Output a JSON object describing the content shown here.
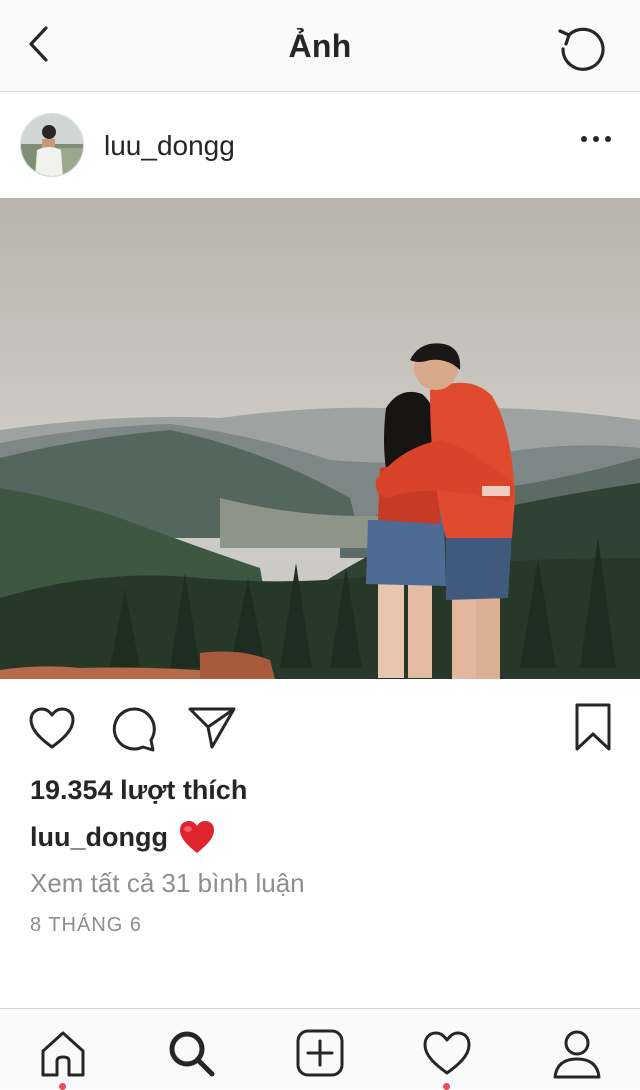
{
  "header": {
    "title": "Ảnh",
    "back_icon": "chevron-left-icon",
    "refresh_icon": "refresh-icon"
  },
  "post": {
    "username": "luu_dongg",
    "more_icon": "more-horizontal-icon",
    "photo_alt": "",
    "likes_text": "19.354 lượt thích",
    "caption_username": "luu_dongg",
    "caption_emoji": "❤️",
    "view_comments_text": "Xem tất cả 31 bình luận",
    "date_text": "8 THÁNG 6"
  },
  "actions": {
    "icons": [
      "heart-icon",
      "comment-icon",
      "share-icon",
      "bookmark-icon"
    ]
  },
  "tabbar": {
    "icons": [
      "home-icon",
      "search-icon",
      "add-icon",
      "activity-heart-icon",
      "profile-icon"
    ]
  },
  "colors": {
    "text": "#262626",
    "muted": "#8e8e8e",
    "notification_dot": "#ed4956",
    "heart_red": "#e0242e"
  }
}
